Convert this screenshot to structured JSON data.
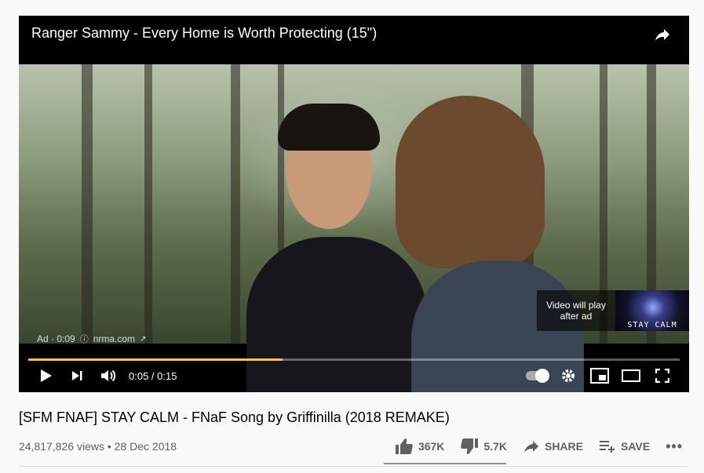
{
  "ad": {
    "title": "Ranger Sammy - Every Home is Worth Protecting (15\")",
    "label": "Ad · 0:09",
    "advertiser": "nrma.com",
    "next_label_line1": "Video will play",
    "next_label_line2": "after ad",
    "next_thumb_text": "STAY CALM",
    "progress_fraction": 0.39
  },
  "controls": {
    "time": "0:05 / 0:15",
    "icons": [
      "play-icon",
      "next-icon",
      "volume-icon",
      "autoplay-toggle-icon",
      "settings-icon",
      "miniplayer-icon",
      "theater-icon",
      "fullscreen-icon"
    ]
  },
  "video": {
    "title": "[SFM FNAF] STAY CALM - FNaF Song by Griffinilla (2018 REMAKE)",
    "views": "24,817,826 views",
    "separator": "•",
    "date": "28 Dec 2018",
    "likes": "367K",
    "dislikes": "5.7K",
    "share_label": "SHARE",
    "save_label": "SAVE",
    "like_fraction": 0.985
  },
  "colors": {
    "progress": "#fbc02d",
    "text_primary": "#030303",
    "text_secondary": "#606060"
  }
}
